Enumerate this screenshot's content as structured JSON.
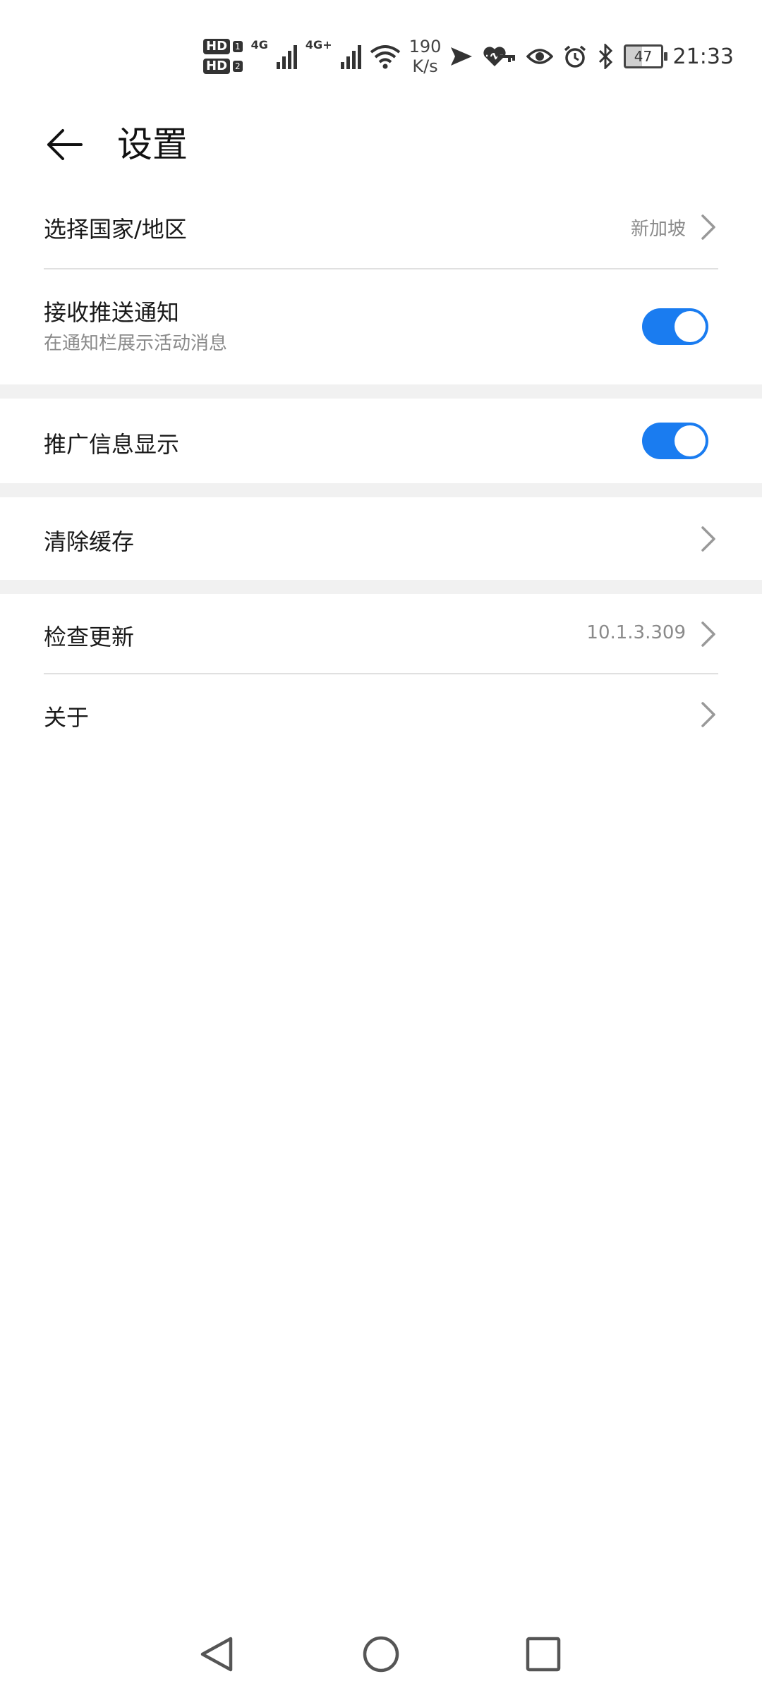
{
  "status_bar": {
    "sim1": "HD",
    "sim1_num": "1",
    "sim2": "HD",
    "sim2_num": "2",
    "network1": "4G",
    "network2": "4G+",
    "speed_value": "190",
    "speed_unit": "K/s",
    "battery": "47",
    "time": "21:33",
    "icons": [
      "wifi-icon",
      "send-icon",
      "heart-icon",
      "key-icon",
      "eye-icon",
      "alarm-icon",
      "bluetooth-icon"
    ]
  },
  "header": {
    "title": "设置",
    "back_icon": "arrow-left-icon"
  },
  "settings": {
    "region": {
      "title": "选择国家/地区",
      "value": "新加坡"
    },
    "push": {
      "title": "接收推送通知",
      "subtitle": "在通知栏展示活动消息",
      "enabled": true
    },
    "promo": {
      "title": "推广信息显示",
      "enabled": true
    },
    "cache": {
      "title": "清除缓存"
    },
    "update": {
      "title": "检查更新",
      "value": "10.1.3.309"
    },
    "about": {
      "title": "关于"
    }
  },
  "colors": {
    "accent": "#1a7cf0",
    "section_gap": "#f1f1f1",
    "divider": "#e0e0e0",
    "secondary_text": "#8a8a8a"
  },
  "navbar": {
    "icons": [
      "back-triangle-icon",
      "home-circle-icon",
      "recents-square-icon"
    ]
  }
}
